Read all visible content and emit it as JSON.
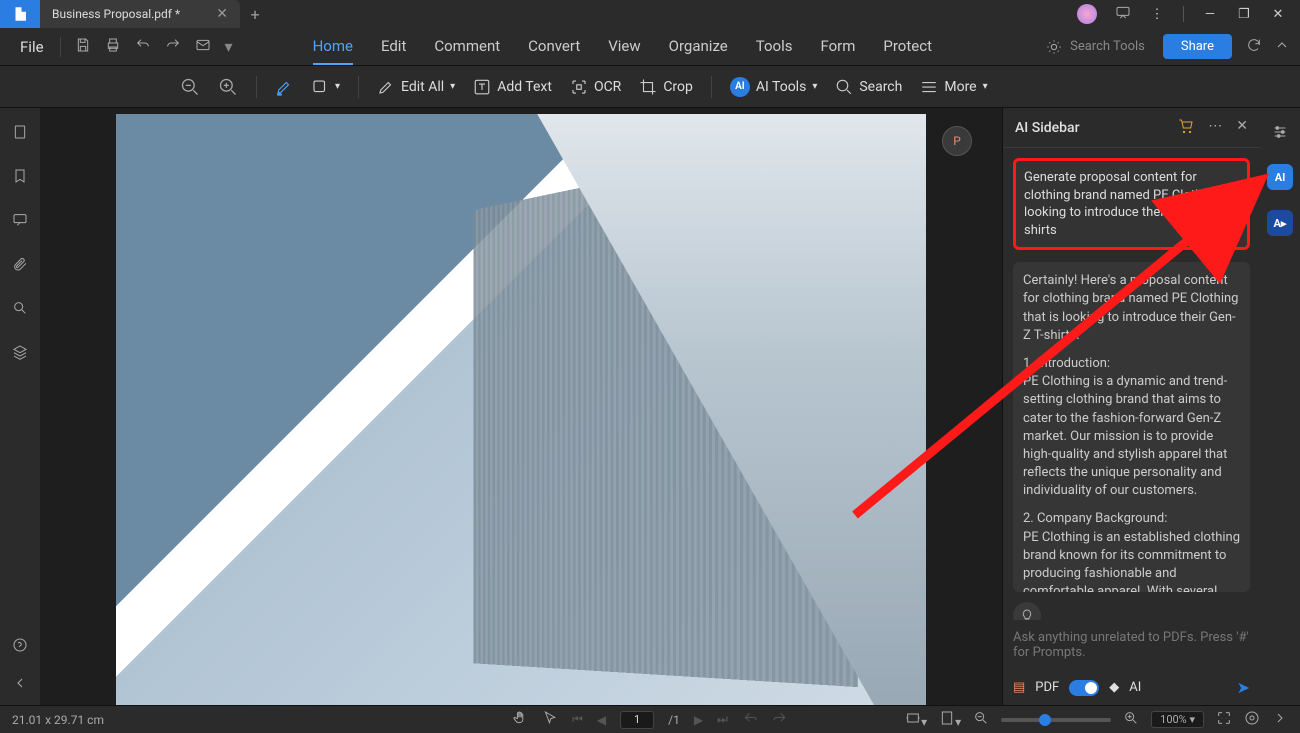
{
  "titlebar": {
    "tab_title": "Business Proposal.pdf *"
  },
  "menubar": {
    "file": "File",
    "tabs": [
      "Home",
      "Edit",
      "Comment",
      "Convert",
      "View",
      "Organize",
      "Tools",
      "Form",
      "Protect"
    ],
    "active_tab": 0,
    "search_tools": "Search Tools",
    "share": "Share"
  },
  "toolbar": {
    "edit_all": "Edit All",
    "add_text": "Add Text",
    "ocr": "OCR",
    "crop": "Crop",
    "ai_tools": "AI Tools",
    "search": "Search",
    "more": "More"
  },
  "ai_sidebar": {
    "title": "AI Sidebar",
    "user_msg": "Generate proposal content for clothing brand named PE Clothing looking to introduce their Gen-Z T-shirts",
    "response_intro": "Certainly! Here's a proposal content for clothing brand named PE Clothing that is looking to introduce their Gen-Z T-shirts:",
    "section1_h": "1. Introduction:",
    "section1": "PE Clothing is a dynamic and trend-setting clothing brand that aims to cater to the fashion-forward Gen-Z market. Our mission is to provide high-quality and stylish apparel that reflects the unique personality and individuality of our customers.",
    "section2_h": "2. Company Background:",
    "section2": "PE Clothing is an established clothing brand known for its commitment to producing fashionable and comfortable apparel. With several years of experience in the industry, we have built a strong",
    "input_placeholder": "Ask anything unrelated to PDFs. Press '#' for Prompts.",
    "pdf_label": "PDF",
    "ai_label": "AI"
  },
  "statusbar": {
    "dimensions": "21.01 x 29.71 cm",
    "page_current": "1",
    "page_total": "/1",
    "zoom": "100%"
  }
}
